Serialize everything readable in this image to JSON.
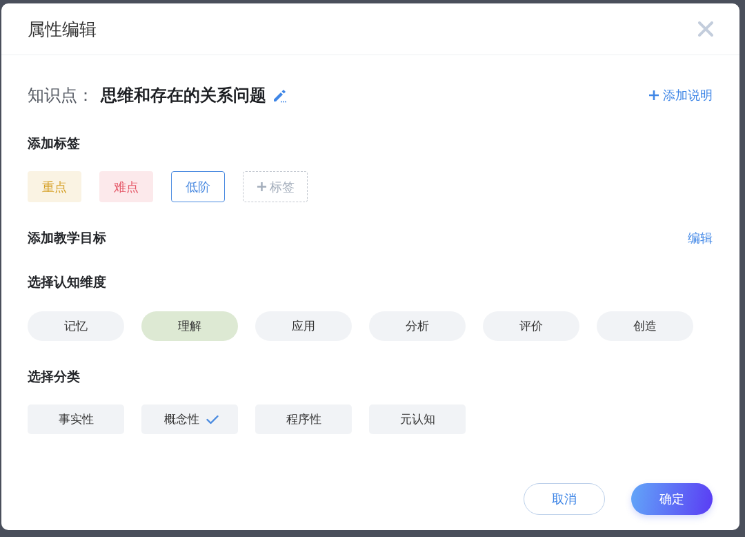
{
  "dialog": {
    "title": "属性编辑"
  },
  "knowledge_point": {
    "label": "知识点：",
    "value": "思维和存在的关系问题",
    "add_note_link": "添加说明"
  },
  "tag_section": {
    "heading": "添加标签",
    "tags": [
      {
        "label": "重点",
        "kind": "filled",
        "color": "#d6a22a"
      },
      {
        "label": "难点",
        "kind": "filled",
        "color": "#e55a6a"
      },
      {
        "label": "低阶",
        "kind": "outline",
        "color": "#4a8ae0"
      }
    ],
    "add_tag_button": "标签"
  },
  "goal_section": {
    "heading": "添加教学目标",
    "edit_link": "编辑"
  },
  "cognitive_section": {
    "heading": "选择认知维度",
    "options": [
      {
        "label": "记忆",
        "selected": false
      },
      {
        "label": "理解",
        "selected": true
      },
      {
        "label": "应用",
        "selected": false
      },
      {
        "label": "分析",
        "selected": false
      },
      {
        "label": "评价",
        "selected": false
      },
      {
        "label": "创造",
        "selected": false
      }
    ]
  },
  "category_section": {
    "heading": "选择分类",
    "options": [
      {
        "label": "事实性",
        "selected": false
      },
      {
        "label": "概念性",
        "selected": true
      },
      {
        "label": "程序性",
        "selected": false
      },
      {
        "label": "元认知",
        "selected": false
      }
    ]
  },
  "buttons": [
    {
      "label": "取消",
      "kind": "secondary"
    },
    {
      "label": "确定",
      "kind": "primary"
    }
  ]
}
